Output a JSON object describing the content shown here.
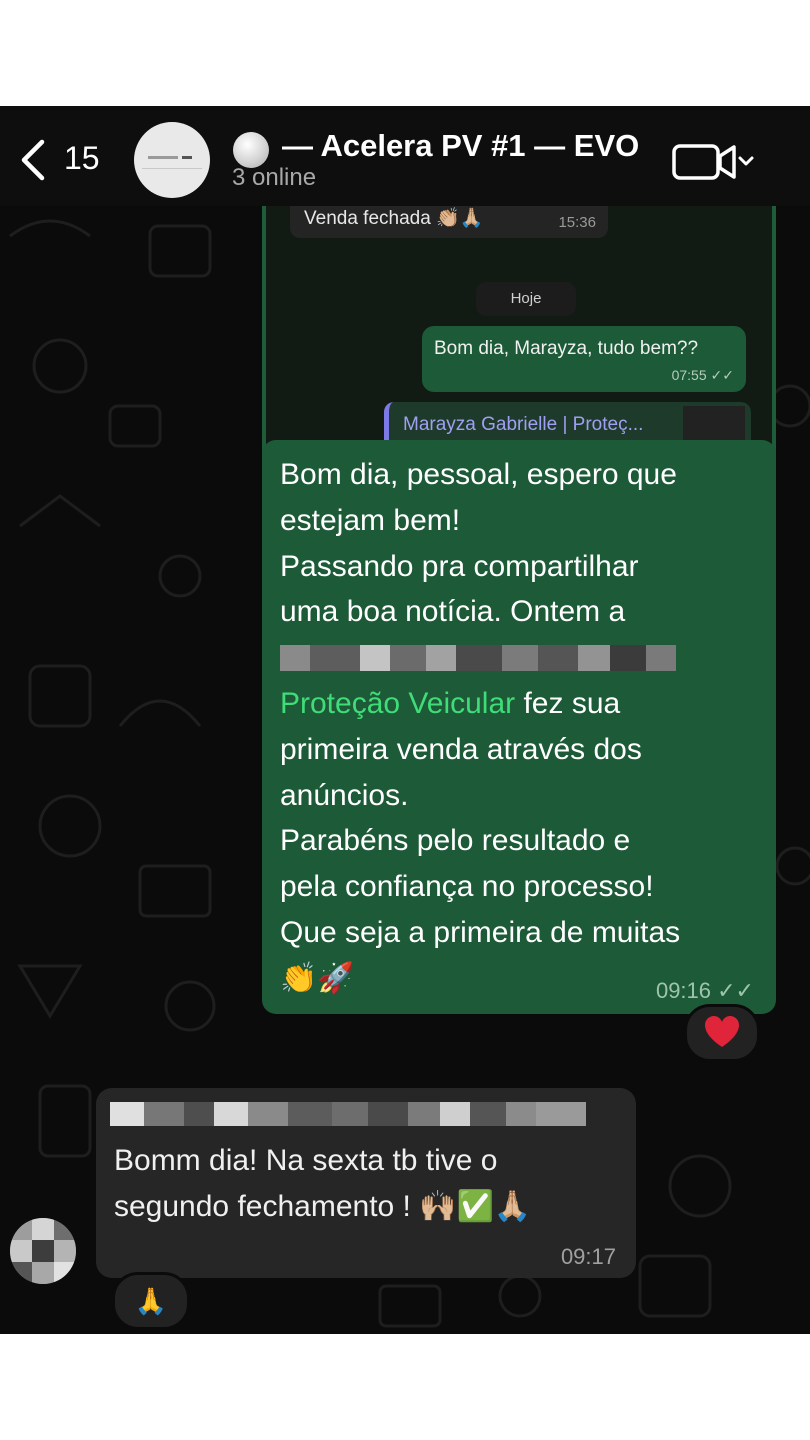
{
  "header": {
    "back_count": "15",
    "title": "— Acelera PV #1 — EVO",
    "subtitle": "3 online",
    "icons": [
      "back-chevron-icon",
      "group-avatar",
      "video-call-icon",
      "chevron-down-icon"
    ]
  },
  "forwarded_screenshot": {
    "previous_message": "Venda fechada 👏🏼🙏🏼",
    "previous_time": "15:36",
    "day_divider": "Hoje",
    "out_message": "Bom dia, Marayza, tudo bem??",
    "out_time": "07:55",
    "link_preview_title": "Marayza Gabrielle | Proteç..."
  },
  "main_message": {
    "line1": "Bom dia, pessoal, espero que",
    "line2": "estejam bem!",
    "line3": "Passando pra compartilhar",
    "line4": "uma boa notícia. Ontem a",
    "highlight": "Proteção Veicular",
    "line6_rest": " fez sua",
    "line7": "primeira venda através dos",
    "line8": "anúncios.",
    "line9": "Parabéns pelo resultado e",
    "line10": "pela confiança no processo!",
    "line11": "Que seja a primeira de muitas",
    "emojis": "👏🚀",
    "time": "09:16",
    "reaction": "❤️"
  },
  "incoming_message": {
    "line1": "Bomm dia! Na sexta tb tive o",
    "line2": "segundo fechamento ! 🙌🏼✅🙏🏼",
    "time": "09:17",
    "reaction": "🙏"
  },
  "colors": {
    "outgoing_bubble": "#1d5a38",
    "incoming_bubble": "#262626",
    "highlight_text": "#3fdc78",
    "background": "#0b0b0b"
  }
}
